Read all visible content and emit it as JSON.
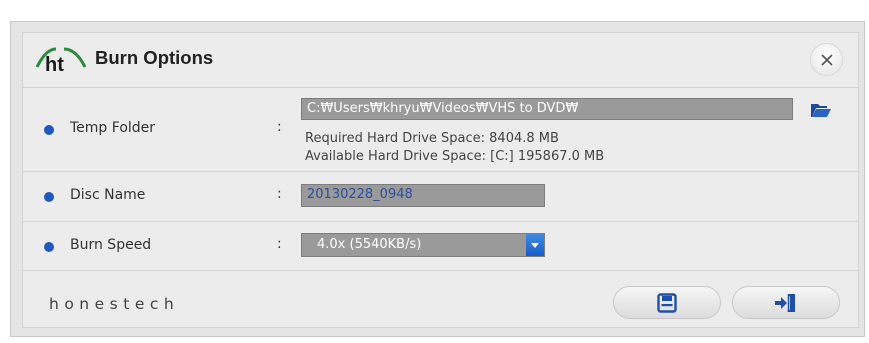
{
  "dialog": {
    "title": "Burn Options",
    "logo_text": "ht",
    "close_icon": "close-icon"
  },
  "temp_folder": {
    "label": "Temp Folder",
    "colon": ":",
    "path": "C:₩Users₩khryu₩Videos₩VHS to DVD₩",
    "required_space": "Required Hard Drive Space: 8404.8 MB",
    "available_space": "Available Hard Drive Space: [C:] 195867.0 MB",
    "browse_icon": "folder-open-icon"
  },
  "disc_name": {
    "label": "Disc Name",
    "colon": ":",
    "value": "20130228_0948"
  },
  "burn_speed": {
    "label": "Burn Speed",
    "colon": ":",
    "selected": "4.0x (5540KB/s)"
  },
  "footer": {
    "brand": "honestech",
    "save_icon": "save-icon",
    "exit_icon": "exit-icon"
  },
  "colors": {
    "accent_blue": "#1f59bd",
    "logo_green": "#2a8a3e",
    "field_gray": "#9a9a9a",
    "background": "#ececec"
  }
}
